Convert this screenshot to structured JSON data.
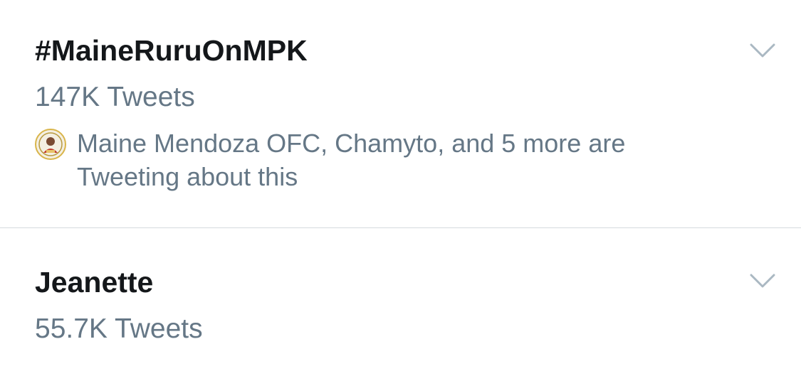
{
  "trends": [
    {
      "name": "#MaineRuruOnMPK",
      "tweet_count": "147K Tweets",
      "context": "Maine Mendoza OFC, Chamyto, and 5 more are Tweeting about this",
      "menu_icon": "chevron-down-icon",
      "avatar_icon": "circular-badge-avatar"
    },
    {
      "name": "Jeanette",
      "tweet_count": "55.7K Tweets",
      "menu_icon": "chevron-down-icon"
    }
  ],
  "colors": {
    "primary_text": "#14171a",
    "secondary_text": "#657786",
    "divider": "#d6dade",
    "chevron": "#aab8c2",
    "avatar_ring": "#d9b54a"
  }
}
